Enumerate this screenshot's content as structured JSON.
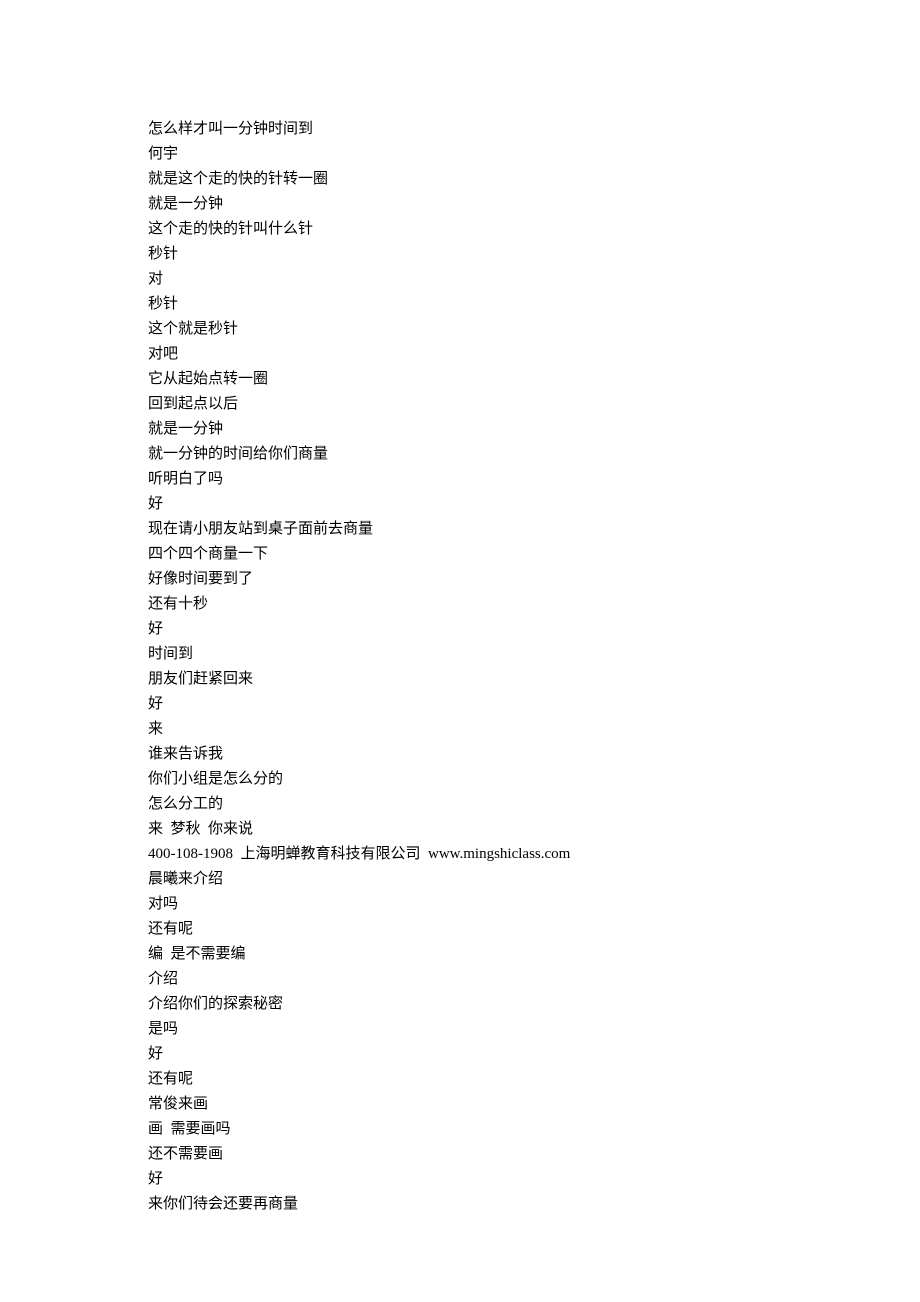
{
  "lines": [
    "怎么样才叫一分钟时间到",
    "何宇",
    "就是这个走的快的针转一圈",
    "就是一分钟",
    "这个走的快的针叫什么针",
    "秒针",
    "对",
    "秒针",
    "这个就是秒针",
    "对吧",
    "它从起始点转一圈",
    "回到起点以后",
    "就是一分钟",
    "就一分钟的时间给你们商量",
    "听明白了吗",
    "好",
    "现在请小朋友站到桌子面前去商量",
    "四个四个商量一下",
    "好像时间要到了",
    "还有十秒",
    "好",
    "时间到",
    "朋友们赶紧回来",
    "好",
    "来",
    "谁来告诉我",
    "你们小组是怎么分的",
    "怎么分工的",
    "来  梦秋  你来说",
    "400-108-1908  上海明蝉教育科技有限公司  www.mingshiclass.com",
    "晨曦来介绍",
    "对吗",
    "还有呢",
    "编  是不需要编",
    "介绍",
    "介绍你们的探索秘密",
    "是吗",
    "好",
    "还有呢",
    "常俊来画",
    "画  需要画吗",
    "还不需要画",
    "好",
    "来你们待会还要再商量"
  ]
}
